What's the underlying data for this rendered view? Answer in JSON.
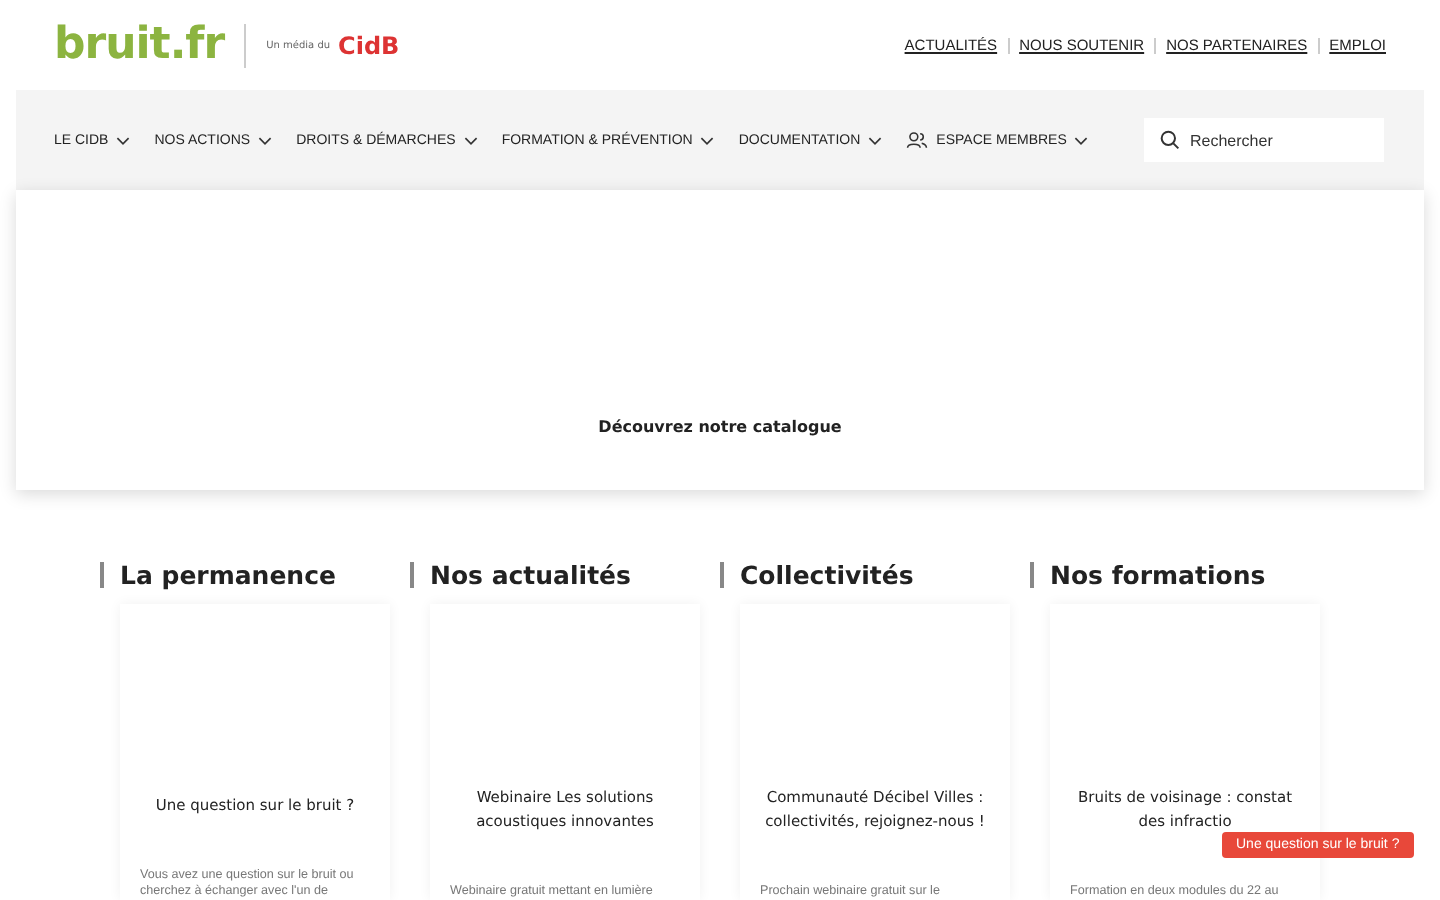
{
  "logo": {
    "site": "bruit.fr",
    "tagline": "Un média du",
    "org": "CidB"
  },
  "top_links": [
    "ACTUALITÉS",
    "NOUS SOUTENIR",
    "NOS PARTENAIRES",
    "EMPLOI"
  ],
  "nav": [
    {
      "label": "LE CIDB",
      "kind": "menu"
    },
    {
      "label": "NOS ACTIONS",
      "kind": "menu"
    },
    {
      "label": "DROITS & DÉMARCHES",
      "kind": "menu"
    },
    {
      "label": "FORMATION & PRÉVENTION",
      "kind": "menu"
    },
    {
      "label": "DOCUMENTATION",
      "kind": "menu"
    },
    {
      "label": "ESPACE MEMBRES",
      "kind": "members"
    }
  ],
  "search": {
    "placeholder": "Rechercher"
  },
  "hero": {
    "link": "Découvrez notre catalogue"
  },
  "sections": [
    {
      "heading": "La permanence",
      "card_title": "Une question sur le bruit ?",
      "card_text": "Vous avez une question sur le bruit ou cherchez à échanger avec l'un de"
    },
    {
      "heading": "Nos actualités",
      "card_title": "Webinaire Les solutions acoustiques innovantes",
      "card_text": "Webinaire gratuit mettant en lumière"
    },
    {
      "heading": "Collectivités",
      "card_title": "Communauté Décibel Villes : collectivités, rejoignez-nous !",
      "card_text": "Prochain webinaire gratuit sur le"
    },
    {
      "heading": "Nos formations",
      "card_title": "Bruits de voisinage : constat des infractio",
      "card_text": "Formation en deux modules du 22 au"
    }
  ],
  "help_button": "Une question sur le bruit ?"
}
